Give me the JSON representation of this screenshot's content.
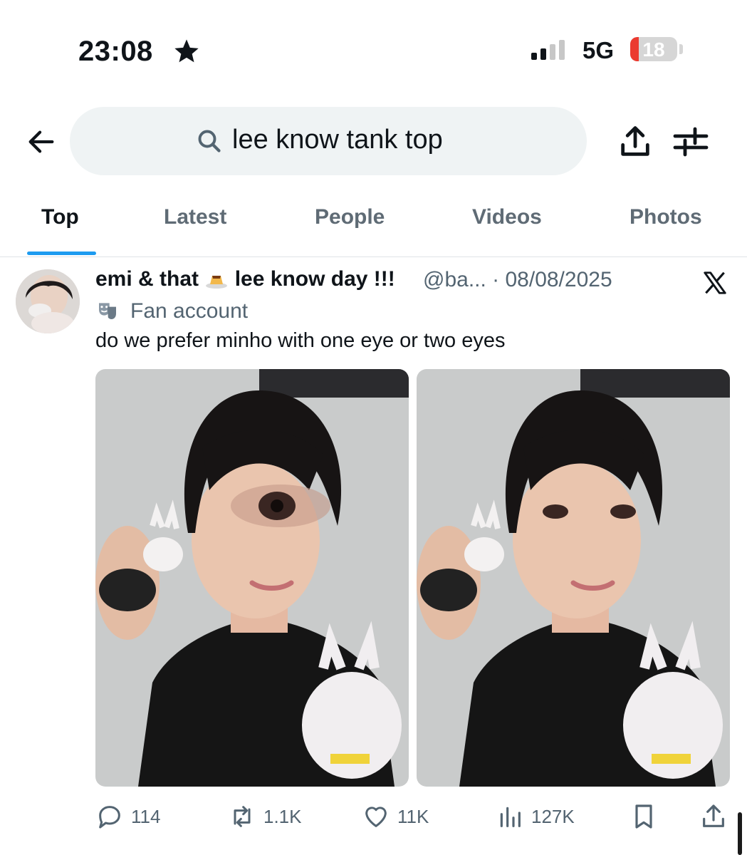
{
  "status_bar": {
    "time": "23:08",
    "network": "5G",
    "battery": "18",
    "battery_color": "#eb3b30"
  },
  "search": {
    "query": "lee know tank top",
    "icons": [
      "back-arrow-icon",
      "search-icon",
      "share-icon",
      "filter-sliders-icon"
    ]
  },
  "tabs": [
    {
      "label": "Top",
      "active": true
    },
    {
      "label": "Latest",
      "active": false
    },
    {
      "label": "People",
      "active": false
    },
    {
      "label": "Videos",
      "active": false
    },
    {
      "label": "Photos",
      "active": false
    }
  ],
  "tweet": {
    "author_name": "emi & that",
    "author_name_after_emoji": "lee know day !!!",
    "handle_and_date": "@ba... · 08/08/2025",
    "affiliation": "Fan account",
    "text": "do we prefer minho with one eye or two eyes",
    "media_count": 2,
    "stats": {
      "replies": "114",
      "reposts": "1.1K",
      "likes": "11K",
      "views": "127K"
    }
  },
  "colors": {
    "accent": "#1d9bf0",
    "text_primary": "#0f1419",
    "text_secondary": "#536471"
  }
}
